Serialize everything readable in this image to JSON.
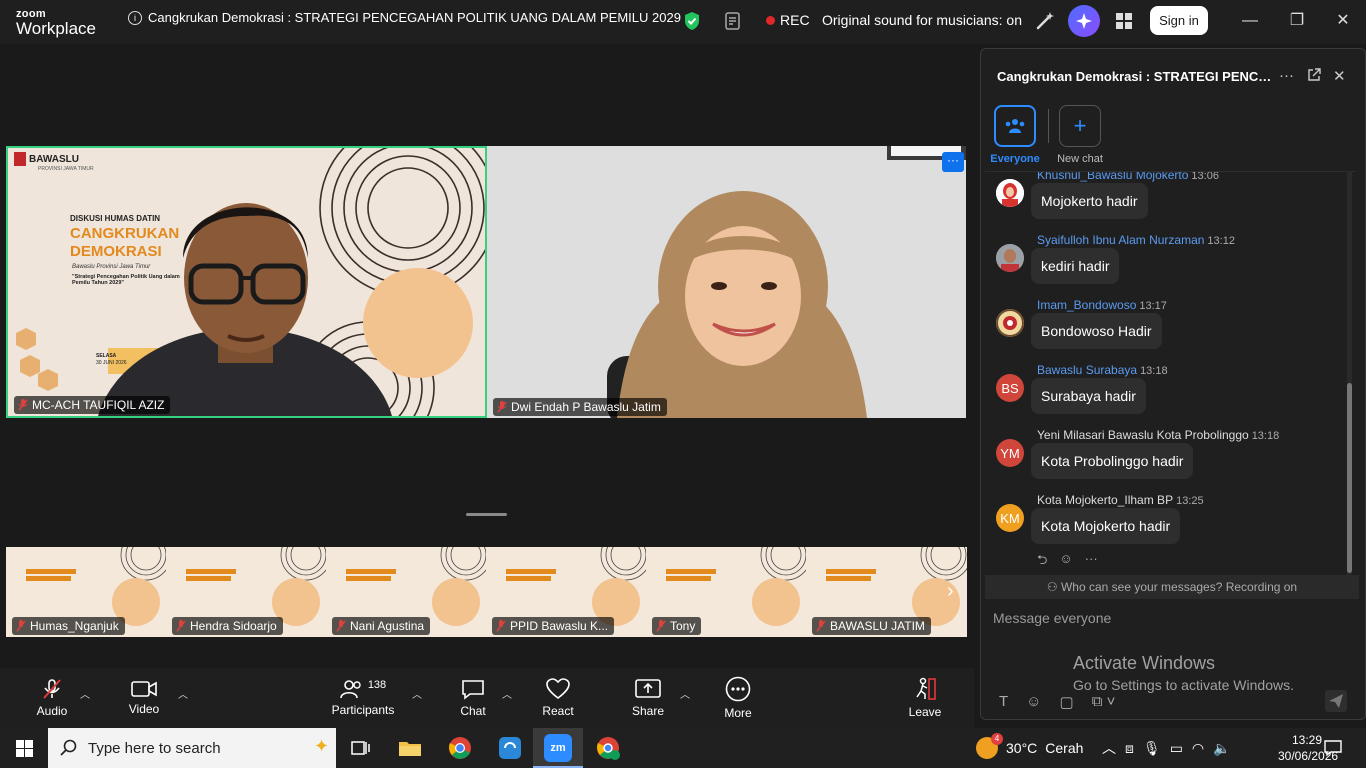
{
  "app": {
    "logo_line1": "zoom",
    "logo_line2": "Workplace",
    "meeting_title": "Cangkrukan Demokrasi : STRATEGI PENCEGAHAN POLITIK UANG DALAM PEMILU 2029",
    "rec_label": "REC",
    "original_sound": "Original sound for musicians: on",
    "signin_label": "Sign in"
  },
  "video": {
    "main_tiles": [
      {
        "name": "MC-ACH TAUFIQIL AZIZ",
        "muted": true,
        "active_speaker": true
      },
      {
        "name": "Dwi Endah P Bawaslu Jatim",
        "muted": true,
        "active_speaker": false
      }
    ],
    "poster": {
      "org": "BAWASLU",
      "org_sub": "PROVINSI JAWA TIMUR",
      "line1": "DISKUSI HUMAS DATIN",
      "line2": "CANGKRUKAN",
      "line3": "DEMOKRASI",
      "line4": "Bawaslu Provinsi Jawa Timur",
      "line5": "\"Strategi Pencegahan Politik Uang dalam Pemilu Tahun 2029\"",
      "day": "SELASA",
      "date": "30 JUNI 2026"
    },
    "thumbnails": [
      {
        "name": "Humas_Nganjuk"
      },
      {
        "name": "Hendra Sidoarjo"
      },
      {
        "name": "Nani Agustina"
      },
      {
        "name": "PPID Bawaslu K..."
      },
      {
        "name": "Tony"
      },
      {
        "name": "BAWASLU JATIM"
      }
    ]
  },
  "toolbar": {
    "audio": "Audio",
    "video": "Video",
    "participants": "Participants",
    "participants_count": "138",
    "chat": "Chat",
    "react": "React",
    "share": "Share",
    "more": "More",
    "leave": "Leave"
  },
  "chat": {
    "title": "Cangkrukan Demokrasi : STRATEGI PENCEGAHAN POLITIK UANG DALAM PEMILU 2029",
    "channels": [
      {
        "label": "Everyone",
        "selected": true
      },
      {
        "label": "New chat",
        "selected": false
      }
    ],
    "messages": [
      {
        "sender": "Khusnul_Bawaslu Mojokerto",
        "time": "13:06",
        "text": "Mojokerto hadir",
        "sender_color": "#5b9bf0",
        "avatar": "photo",
        "avatar_color": "#ffffff"
      },
      {
        "sender": "Syaifulloh Ibnu Alam Nurzaman",
        "time": "13:12",
        "text": "kediri hadir",
        "sender_color": "#5b9bf0",
        "avatar": "photo",
        "avatar_color": "#8a7a6a"
      },
      {
        "sender": "Imam_Bondowoso",
        "time": "13:17",
        "text": "Bondowoso Hadir",
        "sender_color": "#5b9bf0",
        "avatar": "logo",
        "avatar_color": "#f0d9a0"
      },
      {
        "sender": "Bawaslu Surabaya",
        "time": "13:18",
        "text": "Surabaya hadir",
        "sender_color": "#5b9bf0",
        "avatar": "BS",
        "avatar_color": "#d0463a"
      },
      {
        "sender": "Yeni Milasari Bawaslu Kota Probolinggo",
        "time": "13:18",
        "text": "Kota Probolinggo hadir",
        "sender_color": "#dddddd",
        "avatar": "YM",
        "avatar_color": "#d0463a"
      },
      {
        "sender": "Kota Mojokerto_Ilham BP",
        "time": "13:25",
        "text": "Kota Mojokerto hadir",
        "sender_color": "#dddddd",
        "avatar": "KM",
        "avatar_color": "#f0a020"
      }
    ],
    "who_can_see": "Who can see your messages? Recording on",
    "input_placeholder": "Message everyone",
    "watermark_line1": "Activate Windows",
    "watermark_line2": "Go to Settings to activate Windows."
  },
  "taskbar": {
    "search_placeholder": "Type here to search",
    "weather_temp": "30°C",
    "weather_desc": "Cerah",
    "weather_badge": "4",
    "time": "13:29",
    "date": "30/06/2026"
  }
}
